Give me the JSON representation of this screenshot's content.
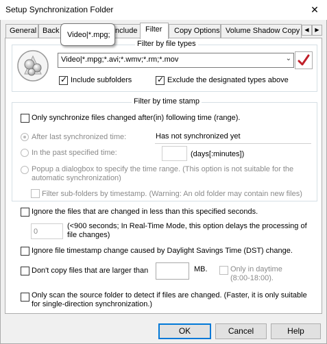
{
  "window": {
    "title": "Setup Synchronization Folder",
    "close_glyph": "✕"
  },
  "tabs": [
    {
      "label": "General"
    },
    {
      "label": "Back"
    },
    {
      "label": "Include"
    },
    {
      "label": "Filter",
      "active": true
    },
    {
      "label": "Copy Options"
    },
    {
      "label": "Volume Shadow Copy"
    }
  ],
  "tab_scroll": {
    "left": "◀",
    "right": "▶"
  },
  "tooltip": {
    "text": "Video|*.mpg;"
  },
  "file_types": {
    "legend": "Filter by file types",
    "combo_value": "Video|*.mpg;*.avi;*.wmv;*.rm;*.mov",
    "combo_caret": "⌄",
    "include_subfolders": {
      "label": "Include subfolders",
      "checked": true
    },
    "exclude_types": {
      "label": "Exclude the designated types above",
      "checked": true
    },
    "icons": {
      "filter": "film-reel-icon",
      "apply": "checkmark-icon"
    },
    "accent_color": "#c0202a"
  },
  "time_stamp": {
    "legend": "Filter by time stamp",
    "only_changed": {
      "label": "Only synchronize files changed after(in) following time (range).",
      "checked": false
    },
    "after_last": {
      "label": "After last synchronized time:",
      "checked": true,
      "value": "Has not synchronized yet"
    },
    "in_past": {
      "label": "In the past specified time:",
      "value": "",
      "unit": "(days[:minutes])"
    },
    "popup": {
      "label": "Popup a dialogbox to specify the time range. (This option is not suitable for the automatic synchronization)"
    },
    "filter_subfolders": {
      "label": "Filter sub-folders by timestamp. (Warning: An old folder may contain new files)"
    }
  },
  "options": {
    "ignore_recent": {
      "label": "Ignore the files that are changed in less than this specified seconds.",
      "checked": false
    },
    "seconds": {
      "value": "0",
      "note": "(<900 seconds; In Real-Time Mode, this option delays the processing of file changes)"
    },
    "ignore_dst": {
      "label": "Ignore file timestamp change caused by Daylight Savings Time (DST) change.",
      "checked": false
    },
    "dont_copy_large": {
      "label": "Don't copy files that are larger than",
      "value": "",
      "unit": "MB."
    },
    "only_daytime": {
      "label": "Only in daytime (8:00-18:00).",
      "checked": false
    },
    "only_scan": {
      "label": "Only scan the source folder to detect if files are changed. (Faster, it is only suitable for single-direction synchronization.)",
      "checked": false
    }
  },
  "buttons": {
    "ok": "OK",
    "cancel": "Cancel",
    "help": "Help"
  }
}
